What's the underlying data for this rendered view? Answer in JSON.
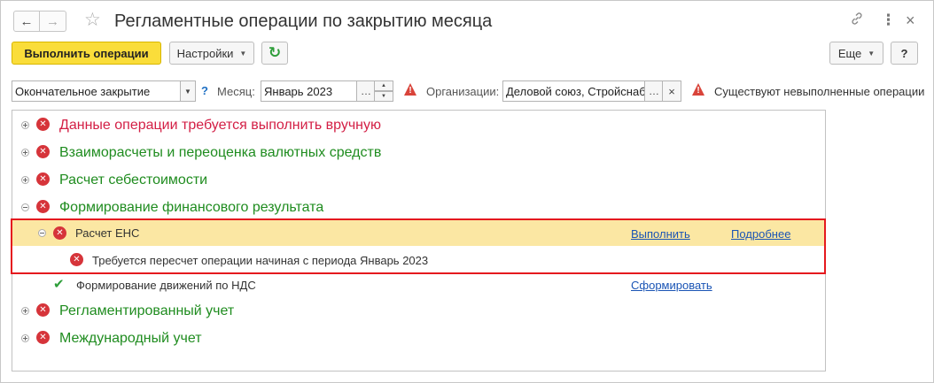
{
  "window": {
    "title": "Регламентные операции по закрытию месяца",
    "back_icon": "←",
    "forward_icon": "→",
    "star_icon": "☆",
    "link_icon": "🔗",
    "more_icon": "⋮",
    "close_icon": "×"
  },
  "toolbar": {
    "run_label": "Выполнить операции",
    "settings_label": "Настройки",
    "refresh_icon": "↻",
    "more_label": "Еще",
    "help_label": "?"
  },
  "filters": {
    "mode_value": "Окончательное закрытие",
    "help_mark": "?",
    "month_label": "Месяц:",
    "month_value": "Январь 2023",
    "org_label": "Организации:",
    "org_value": "Деловой союз, Стройснаб",
    "warning_text": "Существуют невыполненные операции"
  },
  "tree": {
    "groups": [
      {
        "label": "Данные операции требуется выполнить вручную"
      },
      {
        "label": "Взаиморасчеты и переоценка валютных средств"
      },
      {
        "label": "Расчет себестоимости"
      },
      {
        "label": "Формирование финансового результата"
      },
      {
        "label": "Регламентированный учет"
      },
      {
        "label": "Международный учет"
      }
    ],
    "ens": {
      "label": "Расчет ЕНС",
      "action_label": "Выполнить",
      "details_label": "Подробнее",
      "error_text": "Требуется пересчет операции начиная с периода Январь 2023"
    },
    "vat": {
      "label": "Формирование движений по НДС",
      "action_label": "Сформировать"
    }
  },
  "colors": {
    "accent_yellow": "#fadd3a",
    "error_red": "#d6343a",
    "group_green": "#1f8c1f",
    "group_red": "#d31f45",
    "highlight": "#fbe7a3",
    "link": "#1a54b5"
  }
}
